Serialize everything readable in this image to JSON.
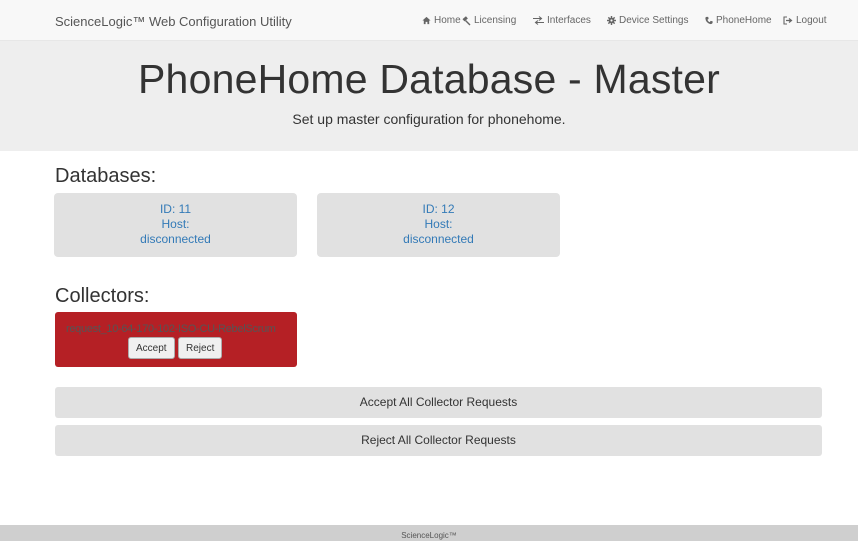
{
  "navbar": {
    "brand": "ScienceLogic™ Web Configuration Utility",
    "items": [
      {
        "label": "Home",
        "icon": "home-icon"
      },
      {
        "label": "Licensing",
        "icon": "gavel-icon"
      },
      {
        "label": "Interfaces",
        "icon": "swap-arrows-icon"
      },
      {
        "label": "Device Settings",
        "icon": "gear-icon"
      },
      {
        "label": "PhoneHome",
        "icon": "phone-icon"
      },
      {
        "label": "Logout",
        "icon": "logout-icon"
      }
    ]
  },
  "header": {
    "title": "PhoneHome Database - Master",
    "subtitle": "Set up master configuration for phonehome."
  },
  "databases": {
    "heading": "Databases:",
    "items": [
      {
        "id": "ID: 11",
        "host": "Host:",
        "status": "disconnected"
      },
      {
        "id": "ID: 12",
        "host": "Host:",
        "status": "disconnected"
      }
    ]
  },
  "collectors": {
    "heading": "Collectors:",
    "items": [
      {
        "name": "request_10-64-170-102-ISO-CU-RebelScrum",
        "accept_label": "Accept",
        "reject_label": "Reject"
      }
    ]
  },
  "actions": {
    "accept_all": "Accept All Collector Requests",
    "reject_all": "Reject All Collector Requests"
  },
  "footer": {
    "text": "ScienceLogic™"
  },
  "colors": {
    "collector_request_bg": "#b52025",
    "link_blue": "#337ab7"
  }
}
